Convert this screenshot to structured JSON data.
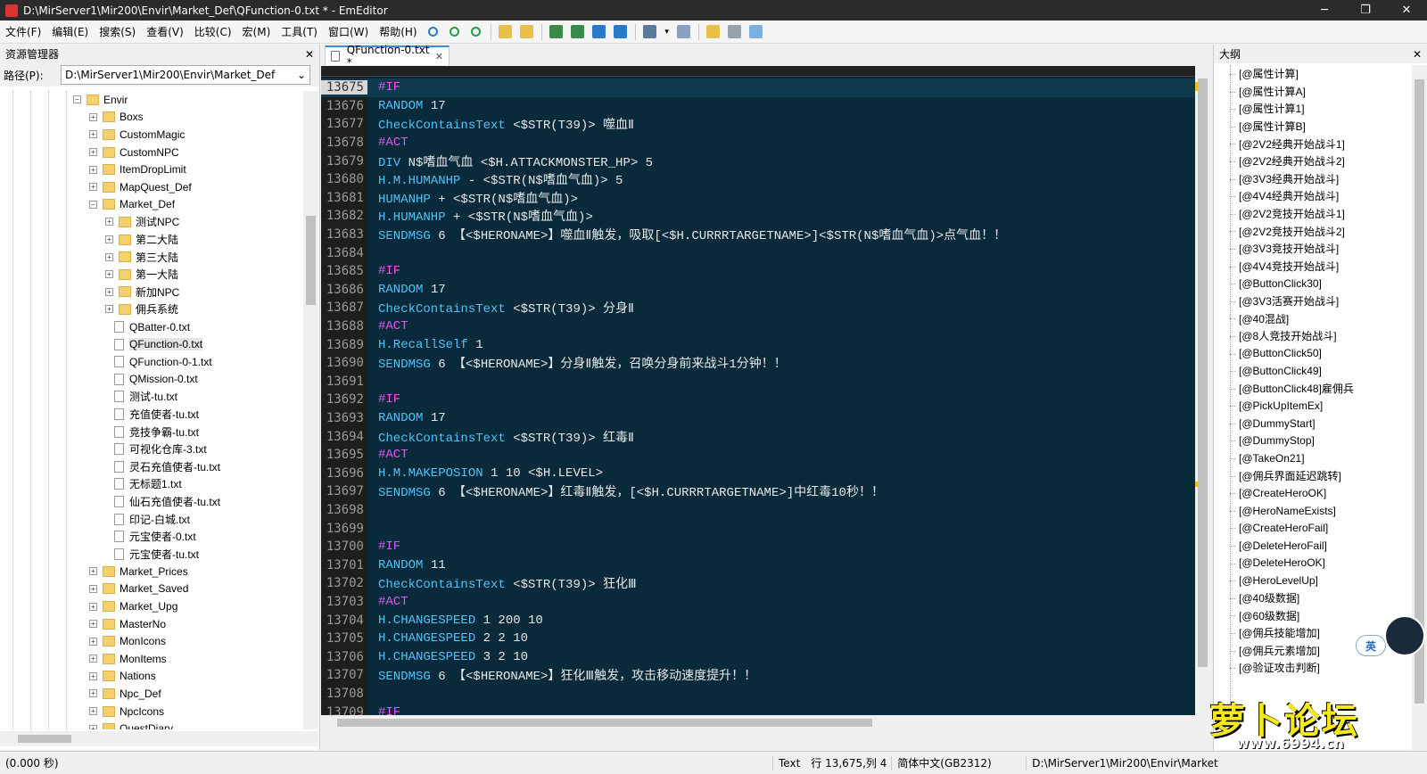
{
  "window": {
    "title": "D:\\MirServer1\\Mir200\\Envir\\Market_Def\\QFunction-0.txt * - EmEditor"
  },
  "menu": [
    "文件(F)",
    "编辑(E)",
    "搜索(S)",
    "查看(V)",
    "比较(C)",
    "宏(M)",
    "工具(T)",
    "窗口(W)",
    "帮助(H)"
  ],
  "left_panel": {
    "title": "资源管理器",
    "path_label": "路径(P):",
    "path_value": "D:\\MirServer1\\Mir200\\Envir\\Market_Def",
    "tree": [
      {
        "label": "Envir",
        "level": 0,
        "type": "folder",
        "exp": "−"
      },
      {
        "label": "Boxs",
        "level": 1,
        "type": "folder",
        "exp": "+"
      },
      {
        "label": "CustomMagic",
        "level": 1,
        "type": "folder",
        "exp": "+"
      },
      {
        "label": "CustomNPC",
        "level": 1,
        "type": "folder",
        "exp": "+"
      },
      {
        "label": "ItemDropLimit",
        "level": 1,
        "type": "folder",
        "exp": "+"
      },
      {
        "label": "MapQuest_Def",
        "level": 1,
        "type": "folder",
        "exp": "+"
      },
      {
        "label": "Market_Def",
        "level": 1,
        "type": "folder",
        "exp": "−"
      },
      {
        "label": "测试NPC",
        "level": 2,
        "type": "folder",
        "exp": "+"
      },
      {
        "label": "第二大陆",
        "level": 2,
        "type": "folder",
        "exp": "+"
      },
      {
        "label": "第三大陆",
        "level": 2,
        "type": "folder",
        "exp": "+"
      },
      {
        "label": "第一大陆",
        "level": 2,
        "type": "folder",
        "exp": "+"
      },
      {
        "label": "新加NPC",
        "level": 2,
        "type": "folder",
        "exp": "+"
      },
      {
        "label": "佣兵系统",
        "level": 2,
        "type": "folder",
        "exp": "+"
      },
      {
        "label": "QBatter-0.txt",
        "level": 2,
        "type": "file"
      },
      {
        "label": "QFunction-0.txt",
        "level": 2,
        "type": "file",
        "selected": true
      },
      {
        "label": "QFunction-0-1.txt",
        "level": 2,
        "type": "file"
      },
      {
        "label": "QMission-0.txt",
        "level": 2,
        "type": "file"
      },
      {
        "label": "测试-tu.txt",
        "level": 2,
        "type": "file"
      },
      {
        "label": "充值使者-tu.txt",
        "level": 2,
        "type": "file"
      },
      {
        "label": "竞技争霸-tu.txt",
        "level": 2,
        "type": "file"
      },
      {
        "label": "可视化仓库-3.txt",
        "level": 2,
        "type": "file"
      },
      {
        "label": "灵石充值使者-tu.txt",
        "level": 2,
        "type": "file"
      },
      {
        "label": "无标题1.txt",
        "level": 2,
        "type": "file"
      },
      {
        "label": "仙石充值使者-tu.txt",
        "level": 2,
        "type": "file"
      },
      {
        "label": "印记-白城.txt",
        "level": 2,
        "type": "file"
      },
      {
        "label": "元宝使者-0.txt",
        "level": 2,
        "type": "file"
      },
      {
        "label": "元宝使者-tu.txt",
        "level": 2,
        "type": "file"
      },
      {
        "label": "Market_Prices",
        "level": 1,
        "type": "folder",
        "exp": "+"
      },
      {
        "label": "Market_Saved",
        "level": 1,
        "type": "folder",
        "exp": "+"
      },
      {
        "label": "Market_Upg",
        "level": 1,
        "type": "folder",
        "exp": "+"
      },
      {
        "label": "MasterNo",
        "level": 1,
        "type": "folder",
        "exp": "+"
      },
      {
        "label": "MonIcons",
        "level": 1,
        "type": "folder",
        "exp": "+"
      },
      {
        "label": "MonItems",
        "level": 1,
        "type": "folder",
        "exp": "+"
      },
      {
        "label": "Nations",
        "level": 1,
        "type": "folder",
        "exp": "+"
      },
      {
        "label": "Npc_Def",
        "level": 1,
        "type": "folder",
        "exp": "+"
      },
      {
        "label": "NpcIcons",
        "level": 1,
        "type": "folder",
        "exp": "+"
      },
      {
        "label": "QuestDiary",
        "level": 1,
        "type": "folder",
        "exp": "+"
      }
    ]
  },
  "tab": {
    "label": "QFunction-0.txt *"
  },
  "editor": {
    "lines": [
      {
        "n": "13675",
        "parts": [
          [
            "kw",
            "#IF"
          ]
        ],
        "current": true
      },
      {
        "n": "13676",
        "parts": [
          [
            "cmd",
            "RANDOM"
          ],
          [
            "",
            " 17"
          ]
        ]
      },
      {
        "n": "13677",
        "parts": [
          [
            "cmd",
            "CheckContainsText"
          ],
          [
            "",
            " <$STR(T39)> 噬血Ⅱ"
          ]
        ]
      },
      {
        "n": "13678",
        "parts": [
          [
            "kw",
            "#ACT"
          ]
        ]
      },
      {
        "n": "13679",
        "parts": [
          [
            "cmd",
            "DIV"
          ],
          [
            "",
            " N$嗜血气血 <$H.ATTACKMONSTER_HP> 5"
          ]
        ]
      },
      {
        "n": "13680",
        "parts": [
          [
            "cmd",
            "H.M.HUMANHP"
          ],
          [
            "",
            " - <$STR(N$嗜血气血)> 5"
          ]
        ]
      },
      {
        "n": "13681",
        "parts": [
          [
            "cmd",
            "HUMANHP"
          ],
          [
            "",
            " + <$STR(N$嗜血气血)>"
          ]
        ]
      },
      {
        "n": "13682",
        "parts": [
          [
            "cmd",
            "H.HUMANHP"
          ],
          [
            "",
            " + <$STR(N$嗜血气血)>"
          ]
        ]
      },
      {
        "n": "13683",
        "parts": [
          [
            "cmd",
            "SENDMSG"
          ],
          [
            "",
            " 6 【<$HERONAME>】噬血Ⅱ触发，吸取[<$H.CURRRTARGETNAME>]<$STR(N$嗜血气血)>点气血！！"
          ]
        ]
      },
      {
        "n": "13684",
        "parts": []
      },
      {
        "n": "13685",
        "parts": [
          [
            "kw",
            "#IF"
          ]
        ]
      },
      {
        "n": "13686",
        "parts": [
          [
            "cmd",
            "RANDOM"
          ],
          [
            "",
            " 17"
          ]
        ]
      },
      {
        "n": "13687",
        "parts": [
          [
            "cmd",
            "CheckContainsText"
          ],
          [
            "",
            " <$STR(T39)> 分身Ⅱ"
          ]
        ]
      },
      {
        "n": "13688",
        "parts": [
          [
            "kw",
            "#ACT"
          ]
        ]
      },
      {
        "n": "13689",
        "parts": [
          [
            "cmd",
            "H.RecallSelf"
          ],
          [
            "",
            " 1"
          ]
        ]
      },
      {
        "n": "13690",
        "parts": [
          [
            "cmd",
            "SENDMSG"
          ],
          [
            "",
            " 6 【<$HERONAME>】分身Ⅱ触发，召唤分身前来战斗1分钟！！"
          ]
        ]
      },
      {
        "n": "13691",
        "parts": []
      },
      {
        "n": "13692",
        "parts": [
          [
            "kw",
            "#IF"
          ]
        ]
      },
      {
        "n": "13693",
        "parts": [
          [
            "cmd",
            "RANDOM"
          ],
          [
            "",
            " 17"
          ]
        ]
      },
      {
        "n": "13694",
        "parts": [
          [
            "cmd",
            "CheckContainsText"
          ],
          [
            "",
            " <$STR(T39)> 红毒Ⅱ"
          ]
        ]
      },
      {
        "n": "13695",
        "parts": [
          [
            "kw",
            "#ACT"
          ]
        ]
      },
      {
        "n": "13696",
        "parts": [
          [
            "cmd",
            "H.M.MAKEPOSION"
          ],
          [
            "",
            " 1 10 <$H.LEVEL>"
          ]
        ]
      },
      {
        "n": "13697",
        "parts": [
          [
            "cmd",
            "SENDMSG"
          ],
          [
            "",
            " 6 【<$HERONAME>】红毒Ⅱ触发，[<$H.CURRRTARGETNAME>]中红毒10秒！！"
          ]
        ]
      },
      {
        "n": "13698",
        "parts": []
      },
      {
        "n": "13699",
        "parts": []
      },
      {
        "n": "13700",
        "parts": [
          [
            "kw",
            "#IF"
          ]
        ]
      },
      {
        "n": "13701",
        "parts": [
          [
            "cmd",
            "RANDOM"
          ],
          [
            "",
            " 11"
          ]
        ]
      },
      {
        "n": "13702",
        "parts": [
          [
            "cmd",
            "CheckContainsText"
          ],
          [
            "",
            " <$STR(T39)> 狂化Ⅲ"
          ]
        ]
      },
      {
        "n": "13703",
        "parts": [
          [
            "kw",
            "#ACT"
          ]
        ]
      },
      {
        "n": "13704",
        "parts": [
          [
            "cmd",
            "H.CHANGESPEED"
          ],
          [
            "",
            " 1 200 10"
          ]
        ]
      },
      {
        "n": "13705",
        "parts": [
          [
            "cmd",
            "H.CHANGESPEED"
          ],
          [
            "",
            " 2 2 10"
          ]
        ]
      },
      {
        "n": "13706",
        "parts": [
          [
            "cmd",
            "H.CHANGESPEED"
          ],
          [
            "",
            " 3 2 10"
          ]
        ]
      },
      {
        "n": "13707",
        "parts": [
          [
            "cmd",
            "SENDMSG"
          ],
          [
            "",
            " 6 【<$HERONAME>】狂化Ⅲ触发，攻击移动速度提升！！"
          ]
        ]
      },
      {
        "n": "13708",
        "parts": []
      },
      {
        "n": "13709",
        "parts": [
          [
            "kw",
            "#IF"
          ]
        ]
      }
    ]
  },
  "right_panel": {
    "title": "大纲",
    "items": [
      "[@属性计算]",
      "[@属性计算A]",
      "[@属性计算1]",
      "[@属性计算B]",
      "[@2V2经典开始战斗1]",
      "[@2V2经典开始战斗2]",
      "[@3V3经典开始战斗]",
      "[@4V4经典开始战斗]",
      "[@2V2竞技开始战斗1]",
      "[@2V2竞技开始战斗2]",
      "[@3V3竞技开始战斗]",
      "[@4V4竞技开始战斗]",
      "[@ButtonClick30]",
      "[@3V3活赛开始战斗]",
      "[@40混战]",
      "[@8人竞技开始战斗]",
      "[@ButtonClick50]",
      "[@ButtonClick49]",
      "[@ButtonClick48]雇佣兵",
      "[@PickUpItemEx]",
      "[@DummyStart]",
      "[@DummyStop]",
      "[@TakeOn21]",
      "[@佣兵界面延迟跳转]",
      "[@CreateHeroOK]",
      "[@HeroNameExists]",
      "[@CreateHeroFail]",
      "[@DeleteHeroFail]",
      "[@DeleteHeroOK]",
      "[@HeroLevelUp]",
      "[@40级数据]",
      "[@60级数据]",
      "[@佣兵技能增加]",
      "[@佣兵元素增加]",
      "[@验证攻击判断]"
    ]
  },
  "status": {
    "time": "(0.000 秒)",
    "mode": "Text",
    "position": "行 13,675,列 4",
    "encoding": "简体中文(GB2312)",
    "path": "D:\\MirServer1\\Mir200\\Envir\\Market"
  },
  "ime": {
    "label": "英"
  },
  "watermark": {
    "logo": "萝卜论坛",
    "url": "www.6994.cn"
  },
  "colors": {
    "editor_bg": "#082a3b",
    "keyword": "#dc5cf0",
    "command": "#4fc3f7",
    "accent": "#3c8cdc"
  }
}
